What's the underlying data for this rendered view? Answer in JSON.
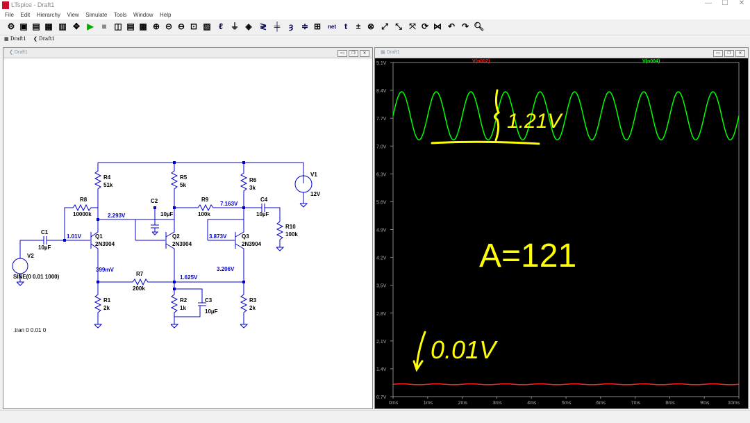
{
  "window": {
    "title": "LTspice - Draft1",
    "min": "—",
    "max": "☐",
    "close": "✕"
  },
  "menu": [
    "File",
    "Edit",
    "Hierarchy",
    "View",
    "Simulate",
    "Tools",
    "Window",
    "Help"
  ],
  "toolbar": {
    "net_label": "net"
  },
  "tabs": [
    "Draft1",
    "Draft1"
  ],
  "schematic_pane": {
    "title": "Draft1",
    "directive": ".tran 0 0.01 0",
    "components": {
      "R4": "R4",
      "R4v": "51k",
      "R5": "R5",
      "R5v": "5k",
      "R6": "R6",
      "R6v": "3k",
      "V1": "V1",
      "V1v": "12V",
      "R8": "R8",
      "R8v": "10000k",
      "C2": "C2",
      "C2v": "10µF",
      "R9": "R9",
      "R9v": "100k",
      "C4": "C4",
      "C4v": "10µF",
      "R10": "R10",
      "R10v": "100k",
      "C1": "C1",
      "C1v": "10µF",
      "V2": "V2",
      "V2v": "SINE(0 0.01 1000)",
      "Q1": "Q1",
      "Q1v": "2N3904",
      "Q2": "Q2",
      "Q2v": "2N3904",
      "Q3": "Q3",
      "Q3v": "2N3904",
      "R7": "R7",
      "R7v": "200k",
      "R1": "R1",
      "R1v": "2k",
      "R2": "R2",
      "R2v": "1k",
      "C3": "C3",
      "C3v": "10µF",
      "R3": "R3",
      "R3v": "2k"
    },
    "node_voltages": {
      "n1": "2.293V",
      "n2": "7.163V",
      "n3": "1.01V",
      "n4": "3.873V",
      "n5": "399mV",
      "n6": "3.206V",
      "n7": "1.625V"
    }
  },
  "plot_pane": {
    "title": "Draft1",
    "annotation_1": "1.21V",
    "annotation_2": "A=121",
    "annotation_3": "0.01V"
  },
  "colors": {
    "green": "#00ff00",
    "red": "#ff2020",
    "blue": "#0000cc",
    "annot": "#ffff00"
  },
  "chart_data": {
    "type": "line",
    "series": [
      {
        "name": "V(n002)",
        "color": "#ff2020",
        "amplitude": 0.01,
        "offset": 1.01,
        "frequency_hz": 1000
      },
      {
        "name": "V(n004)",
        "color": "#00ff00",
        "amplitude": 0.605,
        "offset": 7.76,
        "frequency_hz": 1000
      }
    ],
    "x": {
      "ticks": [
        "0ms",
        "1ms",
        "2ms",
        "3ms",
        "4ms",
        "5ms",
        "6ms",
        "7ms",
        "8ms",
        "9ms",
        "10ms"
      ],
      "range": [
        0,
        10
      ]
    },
    "y": {
      "ticks": [
        "0.7V",
        "1.4V",
        "2.1V",
        "2.8V",
        "3.5V",
        "4.2V",
        "4.9V",
        "5.6V",
        "6.3V",
        "7.0V",
        "7.7V",
        "8.4V",
        "9.1V"
      ],
      "range": [
        0.7,
        9.1
      ]
    },
    "grid": false
  }
}
